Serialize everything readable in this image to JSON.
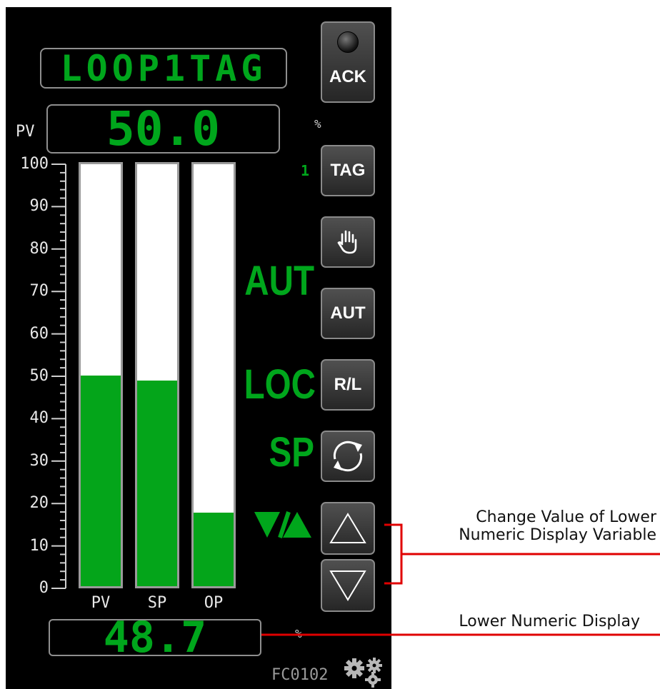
{
  "faceplate": {
    "loop_tag": "LOOP1TAG",
    "pv_label": "PV",
    "pv_value": "50.0",
    "pv_unit": "%",
    "loop_number": "1",
    "mode_auto": "AUT",
    "mode_local": "LOC",
    "mode_setpoint": "SP",
    "mode_arrows": "▼/▲",
    "lower_value": "48.7",
    "lower_unit": "%",
    "fc_tag": "FC0102"
  },
  "buttons": {
    "ack": "ACK",
    "tag": "TAG",
    "manual_icon": "hand-icon",
    "auto": "AUT",
    "remote_local": "R/L",
    "cycle_icon": "cycle-arrows-icon",
    "up_icon": "triangle-up-icon",
    "down_icon": "triangle-down-icon",
    "settings_icon": "gears-icon"
  },
  "chart_data": {
    "type": "bar",
    "categories": [
      "PV",
      "SP",
      "OP"
    ],
    "values": [
      50.0,
      48.7,
      17.5
    ],
    "ylim": [
      0,
      100
    ],
    "yticks": [
      "100",
      "90",
      "80",
      "70",
      "60",
      "50",
      "40",
      "30",
      "20",
      "10",
      "0"
    ],
    "colors": {
      "fill": "#04a51a",
      "empty": "#ffffff",
      "text": "#00a61c"
    }
  },
  "annotations": {
    "change_value_line1": "Change Value of Lower",
    "change_value_line2": "Numeric Display Variable",
    "lower_display": "Lower Numeric Display",
    "callout_color": "#e00000"
  }
}
